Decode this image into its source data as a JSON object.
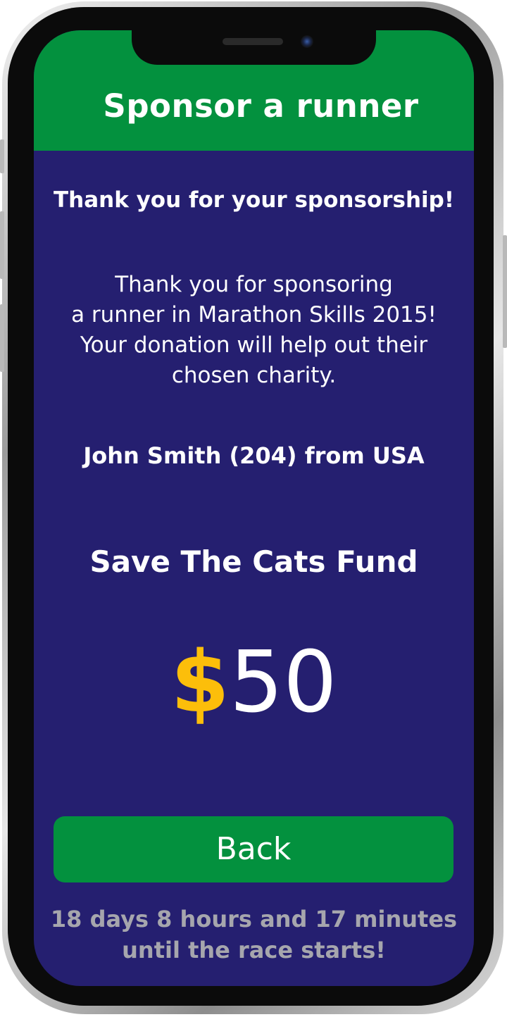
{
  "header": {
    "title": "Sponsor a runner"
  },
  "confirmation": {
    "heading": "Thank you for your sponsorship!",
    "message": "Thank you for sponsoring\na runner in Marathon Skills 2015!\nYour donation will help out their\nchosen charity.",
    "runner": "John Smith (204) from USA",
    "charity": "Save The Cats Fund",
    "currency_symbol": "$",
    "amount": "50"
  },
  "actions": {
    "back_label": "Back"
  },
  "footer": {
    "countdown": "18 days 8 hours and 17 minutes\nuntil the race starts!"
  },
  "colors": {
    "header_green": "#03913e",
    "background_navy": "#251f70",
    "currency_gold": "#fcbe0a",
    "countdown_gray": "#a6a6ad"
  }
}
